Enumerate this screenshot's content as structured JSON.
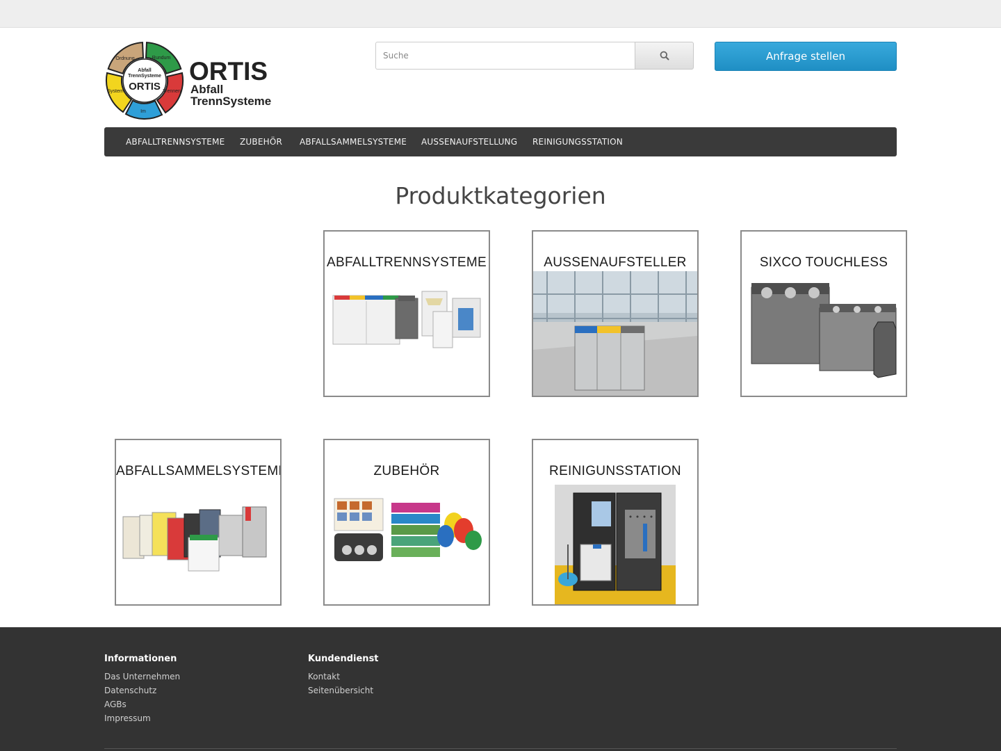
{
  "logo": {
    "brand": "ORTIS",
    "sub1": "Abfall",
    "sub2": "TrennSysteme",
    "ring": [
      "Ordnung",
      "Rundum",
      "Trennen",
      "Im",
      "System"
    ],
    "ring_center_top": "Abfall",
    "ring_center_mid": "TrennSysteme",
    "ring_center_brand": "ORTIS",
    "colors": [
      "#c9a57a",
      "#2e9a48",
      "#d93a3a",
      "#2f9fd8",
      "#f2d51e"
    ]
  },
  "search": {
    "placeholder": "Suche"
  },
  "request_button": "Anfrage stellen",
  "nav": [
    "ABFALLTRENNSYSTEME",
    "ZUBEHÖR",
    "ABFALLSAMMELSYSTEME",
    "AUSSENAUFSTELLUNG",
    "REINIGUNGSSTATION"
  ],
  "page_title": "Produktkategorien",
  "categories": [
    {
      "label": "ABFALLTRENNSYSTEME"
    },
    {
      "label": "AUSSENAUFSTELLER"
    },
    {
      "label": "SIXCO TOUCHLESS"
    },
    {
      "label": "ABFALLSAMMELSYSTEME"
    },
    {
      "label": "ZUBEHÖR"
    },
    {
      "label": "REINIGUNSSTATION"
    }
  ],
  "footer": {
    "info_heading": "Informationen",
    "info_links": [
      "Das Unternehmen",
      "Datenschutz",
      "AGBs",
      "Impressum"
    ],
    "service_heading": "Kundendienst",
    "service_links": [
      "Kontakt",
      "Seitenübersicht"
    ]
  }
}
